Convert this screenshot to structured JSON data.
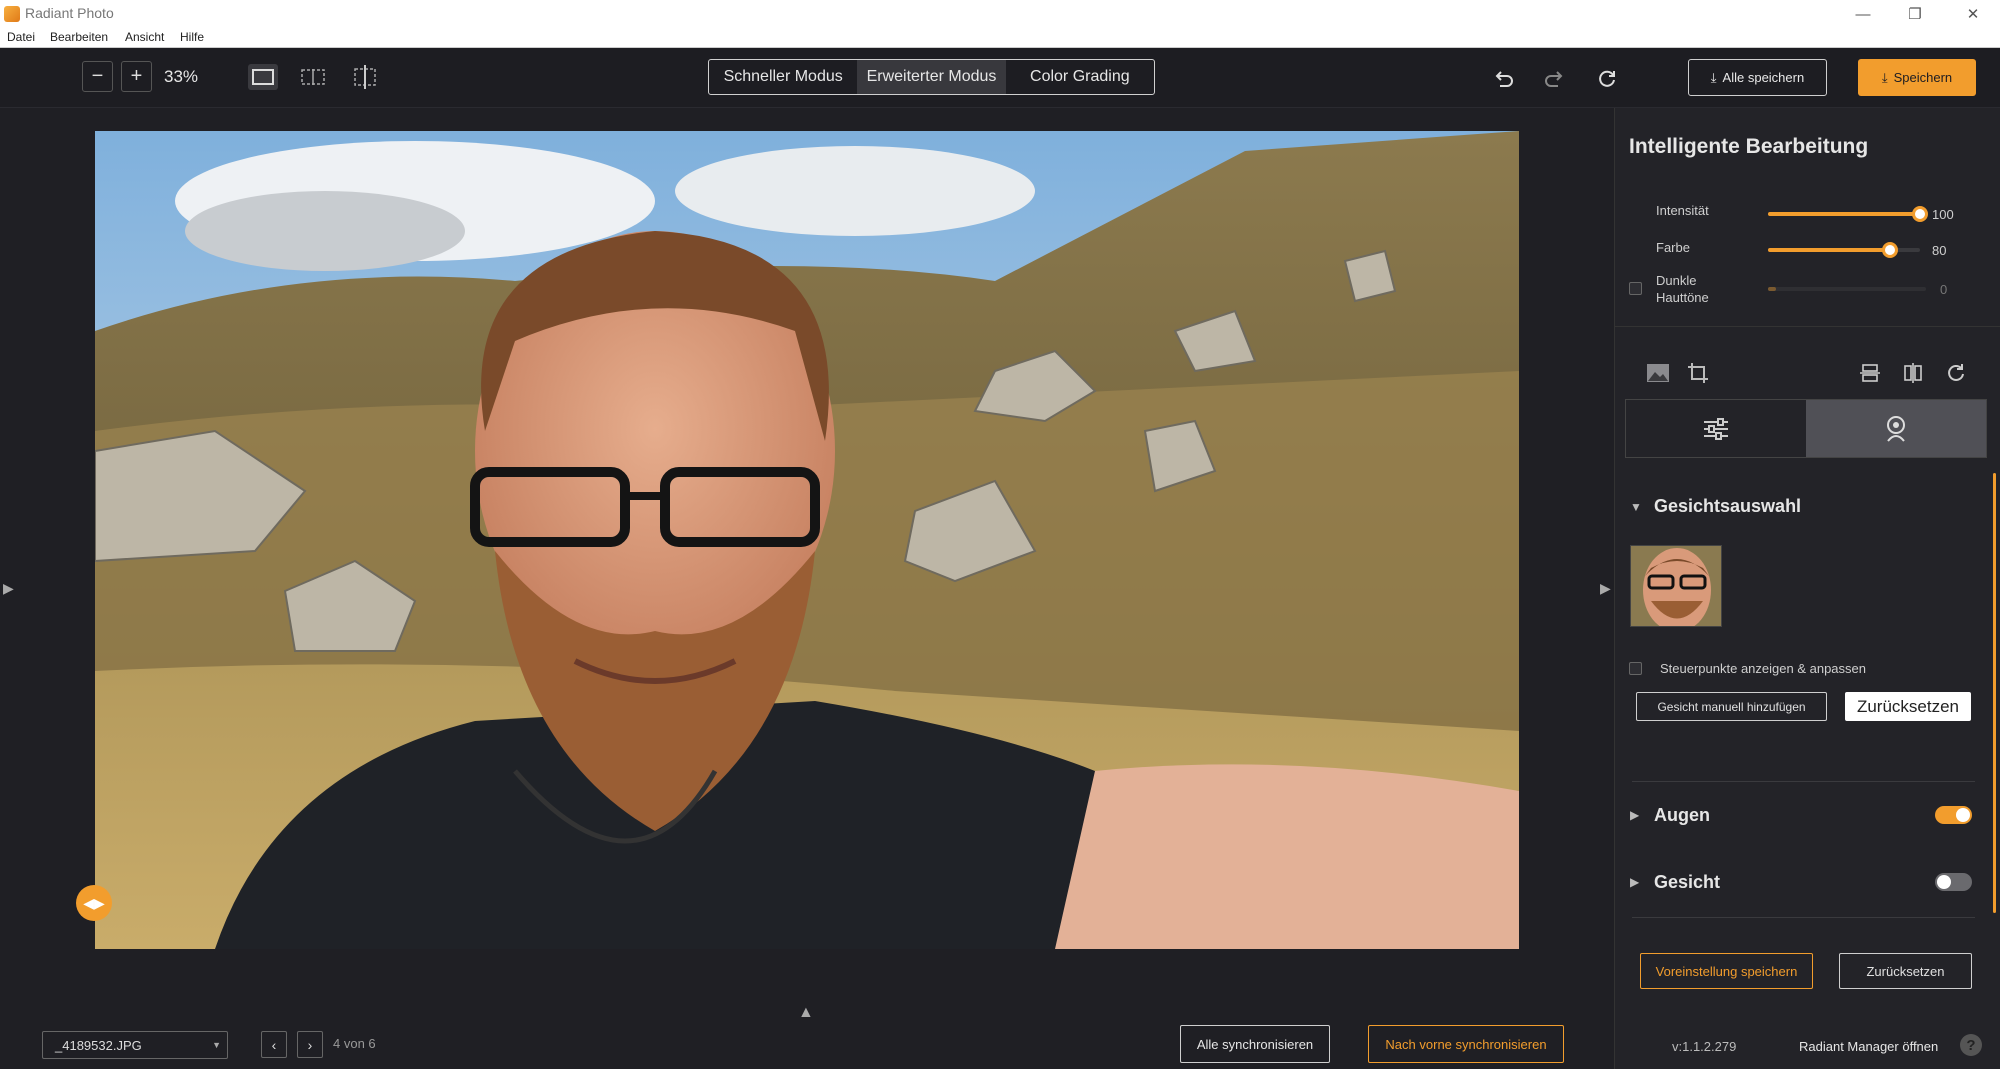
{
  "window": {
    "title": "Radiant Photo",
    "minimize_icon": "minimize-icon",
    "restore_icon": "restore-icon",
    "close_icon": "close-icon"
  },
  "menu": [
    "Datei",
    "Bearbeiten",
    "Ansicht",
    "Hilfe"
  ],
  "toolbar": {
    "zoom_out": "−",
    "zoom_in": "+",
    "zoom_level": "33%",
    "modes": [
      "Schneller Modus",
      "Erweiterter Modus",
      "Color Grading"
    ],
    "active_mode": "Erweiterter Modus",
    "save_all_label": "Alle speichern",
    "save_label": "Speichern"
  },
  "bottom": {
    "filename": "_4189532.JPG",
    "page_info": "4 von 6",
    "sync_all_label": "Alle synchronisieren",
    "sync_forward_label": "Nach vorne synchronisieren"
  },
  "panel": {
    "title": "Intelligente Bearbeitung",
    "sliders": [
      {
        "label": "Intensität",
        "value": "100",
        "fraction": 1.0
      },
      {
        "label": "Farbe",
        "value": "80",
        "fraction": 0.8
      },
      {
        "label": "Dunkle Hauttöne",
        "value": "0",
        "fraction": 0.0
      }
    ],
    "dark_skin_label_line1": "Dunkle",
    "dark_skin_label_line2": "Hauttöne",
    "face_section_title": "Gesichtsauswahl",
    "control_points_label": "Steuerpunkte anzeigen & anpassen",
    "add_face_label": "Gesicht manuell hinzufügen",
    "reset_face_label": "Zurücksetzen",
    "eyes_label": "Augen",
    "eyes_on": true,
    "face_label": "Gesicht",
    "face_on": false,
    "save_preset_label": "Voreinstellung speichern",
    "reset_label": "Zurücksetzen",
    "version": "v:1.1.2.279",
    "manager_label": "Radiant Manager öffnen",
    "help": "?"
  },
  "colors": {
    "accent": "#f29d2d",
    "bg": "#1f1f24",
    "panel": "#232328"
  }
}
